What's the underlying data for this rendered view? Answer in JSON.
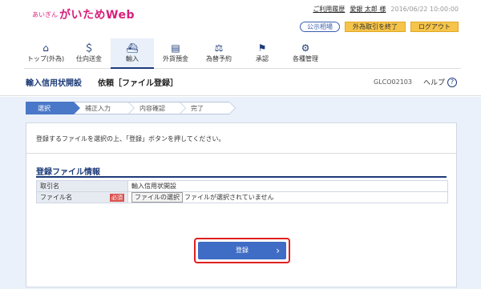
{
  "header": {
    "logo_small": "あいぎん",
    "logo_main": "がいためWeb",
    "help_link": "ご利用履歴",
    "user": "愛銀 太郎 様",
    "datetime": "2016/06/22 10:00:00"
  },
  "buttons": {
    "rates": "公示相場",
    "end_fx": "外為取引を終了",
    "logout": "ログアウト"
  },
  "nav": [
    {
      "label": "トップ(外為)",
      "icon": "⌂"
    },
    {
      "label": "仕向送金",
      "icon": "＄"
    },
    {
      "label": "輸入",
      "icon": "⛴"
    },
    {
      "label": "外貨預金",
      "icon": "▤"
    },
    {
      "label": "為替予約",
      "icon": "⚖"
    },
    {
      "label": "承認",
      "icon": "⚑"
    },
    {
      "label": "各種管理",
      "icon": "⚙"
    }
  ],
  "titlebar": {
    "section": "輸入信用状開設",
    "title": "依頼［ファイル登録］",
    "code": "GLCO02103",
    "help": "ヘルプ"
  },
  "steps": [
    "選択",
    "補正入力",
    "内容確認",
    "完了"
  ],
  "instruction": "登録するファイルを選択の上、「登録」ボタンを押してください。",
  "section_title": "登録ファイル情報",
  "table": {
    "row1": {
      "label": "取引名",
      "value": "輸入信用状開設"
    },
    "row2": {
      "label": "ファイル名",
      "required": "必須",
      "button": "ファイルの選択",
      "value": "ファイルが選択されていません"
    }
  },
  "register_button": "登録",
  "colors": {
    "accent": "#1d3b78",
    "active_step": "#4a78c8",
    "required": "#d9534f",
    "highlight": "#e02020"
  }
}
